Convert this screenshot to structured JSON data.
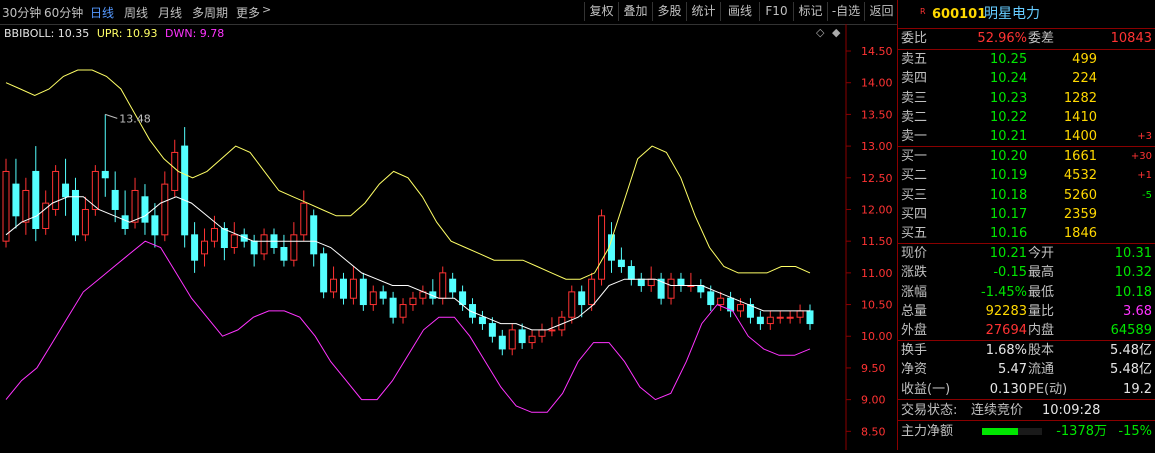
{
  "periods": [
    {
      "label": "30分钟",
      "active": false
    },
    {
      "label": "60分钟",
      "active": false
    },
    {
      "label": "日线",
      "active": true
    },
    {
      "label": "周线",
      "active": false
    },
    {
      "label": "月线",
      "active": false
    },
    {
      "label": "多周期",
      "active": false
    },
    {
      "label": "更多",
      "active": false
    }
  ],
  "tools": [
    "复权",
    "叠加",
    "多股",
    "统计",
    "画线",
    "F10",
    "标记",
    "-自选",
    "返回"
  ],
  "indicator": {
    "name": "BBIBOLL",
    "bbi_text": "BBIBOLL: 10.35",
    "upr_text": "UPR: 10.93",
    "dwn_text": "DWN: 9.78",
    "colors": {
      "bbi": "#ffffff",
      "upr": "#ffff66",
      "dwn": "#ff33ff"
    }
  },
  "chart_data": {
    "type": "candlestick",
    "y_ticks": [
      "14.50",
      "14.00",
      "13.50",
      "13.00",
      "12.50",
      "12.00",
      "11.50",
      "11.00",
      "10.50",
      "10.00",
      "9.50",
      "9.00",
      "8.50"
    ],
    "ylim": [
      8.3,
      14.8
    ],
    "high_annotation": "13.48",
    "candles": [
      [
        11.5,
        12.6,
        11.4,
        12.8
      ],
      [
        12.4,
        11.9,
        11.7,
        12.8
      ],
      [
        11.8,
        12.3,
        11.6,
        12.5
      ],
      [
        12.6,
        11.7,
        11.5,
        13.0
      ],
      [
        11.7,
        12.1,
        11.6,
        12.3
      ],
      [
        12.0,
        12.6,
        11.9,
        12.7
      ],
      [
        12.4,
        12.2,
        11.9,
        12.8
      ],
      [
        12.3,
        11.6,
        11.5,
        12.5
      ],
      [
        11.6,
        12.0,
        11.5,
        12.2
      ],
      [
        12.0,
        12.6,
        11.9,
        12.7
      ],
      [
        12.6,
        12.5,
        12.2,
        13.5
      ],
      [
        12.3,
        12.0,
        11.8,
        12.6
      ],
      [
        11.9,
        11.7,
        11.6,
        12.3
      ],
      [
        11.8,
        12.3,
        11.7,
        12.5
      ],
      [
        12.2,
        11.8,
        11.6,
        12.4
      ],
      [
        11.9,
        11.6,
        11.4,
        12.1
      ],
      [
        11.6,
        12.4,
        11.5,
        12.6
      ],
      [
        12.3,
        12.9,
        12.2,
        13.1
      ],
      [
        13.0,
        11.6,
        11.4,
        13.3
      ],
      [
        11.6,
        11.2,
        11.0,
        11.8
      ],
      [
        11.3,
        11.5,
        11.1,
        11.7
      ],
      [
        11.5,
        11.7,
        11.4,
        11.9
      ],
      [
        11.7,
        11.4,
        11.2,
        11.8
      ],
      [
        11.4,
        11.6,
        11.3,
        11.8
      ],
      [
        11.6,
        11.5,
        11.4,
        11.7
      ],
      [
        11.5,
        11.3,
        11.1,
        11.6
      ],
      [
        11.3,
        11.6,
        11.2,
        11.7
      ],
      [
        11.6,
        11.4,
        11.3,
        11.7
      ],
      [
        11.4,
        11.2,
        11.1,
        11.6
      ],
      [
        11.2,
        11.6,
        11.1,
        11.8
      ],
      [
        11.6,
        12.1,
        11.5,
        12.3
      ],
      [
        11.9,
        11.3,
        11.1,
        12.0
      ],
      [
        11.3,
        10.7,
        10.6,
        11.4
      ],
      [
        10.7,
        10.9,
        10.6,
        11.1
      ],
      [
        10.9,
        10.6,
        10.5,
        11.0
      ],
      [
        10.6,
        10.9,
        10.5,
        11.1
      ],
      [
        10.9,
        10.5,
        10.4,
        11.0
      ],
      [
        10.5,
        10.7,
        10.4,
        10.8
      ],
      [
        10.7,
        10.6,
        10.5,
        10.8
      ],
      [
        10.6,
        10.3,
        10.2,
        10.7
      ],
      [
        10.3,
        10.5,
        10.2,
        10.6
      ],
      [
        10.5,
        10.6,
        10.4,
        10.7
      ],
      [
        10.6,
        10.7,
        10.5,
        10.8
      ],
      [
        10.7,
        10.6,
        10.5,
        10.9
      ],
      [
        10.6,
        11.0,
        10.5,
        11.1
      ],
      [
        10.9,
        10.7,
        10.6,
        11.0
      ],
      [
        10.7,
        10.5,
        10.4,
        10.8
      ],
      [
        10.5,
        10.3,
        10.2,
        10.6
      ],
      [
        10.3,
        10.2,
        10.1,
        10.4
      ],
      [
        10.2,
        10.0,
        9.9,
        10.3
      ],
      [
        10.0,
        9.8,
        9.7,
        10.1
      ],
      [
        9.8,
        10.1,
        9.7,
        10.2
      ],
      [
        10.1,
        9.9,
        9.8,
        10.2
      ],
      [
        9.9,
        10.0,
        9.8,
        10.1
      ],
      [
        10.0,
        10.1,
        9.9,
        10.2
      ],
      [
        10.1,
        10.1,
        10.0,
        10.3
      ],
      [
        10.1,
        10.3,
        10.0,
        10.4
      ],
      [
        10.3,
        10.7,
        10.2,
        10.8
      ],
      [
        10.7,
        10.5,
        10.3,
        10.8
      ],
      [
        10.5,
        10.9,
        10.4,
        11.0
      ],
      [
        10.9,
        11.9,
        10.8,
        12.0
      ],
      [
        11.6,
        11.2,
        11.0,
        11.8
      ],
      [
        11.2,
        11.1,
        11.0,
        11.4
      ],
      [
        11.1,
        10.9,
        10.8,
        11.2
      ],
      [
        10.9,
        10.8,
        10.7,
        11.0
      ],
      [
        10.8,
        10.9,
        10.7,
        11.1
      ],
      [
        10.9,
        10.6,
        10.5,
        11.0
      ],
      [
        10.6,
        10.9,
        10.5,
        11.0
      ],
      [
        10.9,
        10.8,
        10.7,
        11.0
      ],
      [
        10.8,
        10.8,
        10.7,
        11.0
      ],
      [
        10.8,
        10.7,
        10.6,
        10.9
      ],
      [
        10.7,
        10.5,
        10.4,
        10.8
      ],
      [
        10.5,
        10.6,
        10.4,
        10.7
      ],
      [
        10.6,
        10.4,
        10.3,
        10.7
      ],
      [
        10.4,
        10.5,
        10.3,
        10.6
      ],
      [
        10.5,
        10.3,
        10.2,
        10.6
      ],
      [
        10.3,
        10.2,
        10.1,
        10.4
      ],
      [
        10.2,
        10.3,
        10.1,
        10.4
      ],
      [
        10.3,
        10.3,
        10.2,
        10.4
      ],
      [
        10.3,
        10.3,
        10.2,
        10.4
      ],
      [
        10.3,
        10.4,
        10.2,
        10.5
      ],
      [
        10.4,
        10.2,
        10.1,
        10.5
      ]
    ],
    "upr": [
      14.0,
      13.9,
      13.8,
      13.9,
      14.1,
      14.2,
      14.2,
      14.1,
      13.9,
      13.5,
      13.1,
      12.8,
      12.6,
      12.5,
      12.6,
      12.8,
      13.0,
      12.9,
      12.6,
      12.3,
      12.2,
      12.1,
      12.0,
      11.9,
      11.9,
      12.1,
      12.4,
      12.6,
      12.5,
      12.2,
      11.8,
      11.5,
      11.4,
      11.3,
      11.2,
      11.2,
      11.2,
      11.1,
      11.0,
      10.9,
      10.9,
      11.0,
      11.4,
      12.1,
      12.8,
      13.0,
      12.9,
      12.5,
      11.9,
      11.4,
      11.1,
      11.0,
      11.0,
      11.0,
      11.1,
      11.1,
      11.0
    ],
    "upr_x0": 0,
    "bbi": [
      11.6,
      11.8,
      11.9,
      12.1,
      12.2,
      12.2,
      12.0,
      11.9,
      11.8,
      11.9,
      12.1,
      12.2,
      12.1,
      11.9,
      11.7,
      11.6,
      11.5,
      11.5,
      11.5,
      11.5,
      11.5,
      11.4,
      11.2,
      11.0,
      10.9,
      10.8,
      10.8,
      10.7,
      10.6,
      10.6,
      10.4,
      10.3,
      10.2,
      10.2,
      10.1,
      10.1,
      10.2,
      10.3,
      10.5,
      10.8,
      10.9,
      10.9,
      10.9,
      10.8,
      10.8,
      10.8,
      10.7,
      10.6,
      10.5,
      10.4,
      10.4,
      10.4,
      10.4
    ],
    "dwn": [
      9.0,
      9.3,
      9.5,
      9.9,
      10.3,
      10.7,
      10.9,
      11.1,
      11.3,
      11.5,
      11.4,
      11.0,
      10.6,
      10.3,
      10.0,
      10.1,
      10.3,
      10.4,
      10.4,
      10.3,
      10.0,
      9.6,
      9.3,
      9.0,
      9.0,
      9.3,
      9.7,
      10.1,
      10.3,
      10.3,
      10.0,
      9.6,
      9.2,
      8.9,
      8.8,
      8.8,
      9.1,
      9.6,
      9.9,
      9.9,
      9.6,
      9.2,
      9.0,
      9.1,
      9.6,
      10.2,
      10.5,
      10.4,
      10.0,
      9.8,
      9.7,
      9.7,
      9.8
    ]
  },
  "stock": {
    "badge": "R",
    "code": "600101",
    "name": "明星电力"
  },
  "wei": {
    "weibi_label": "委比",
    "weibi_value": "52.96%",
    "weicha_label": "委差",
    "weicha_value": "10843"
  },
  "asks": [
    {
      "label": "卖五",
      "price": "10.25",
      "vol": "499",
      "chg": ""
    },
    {
      "label": "卖四",
      "price": "10.24",
      "vol": "224",
      "chg": ""
    },
    {
      "label": "卖三",
      "price": "10.23",
      "vol": "1282",
      "chg": ""
    },
    {
      "label": "卖二",
      "price": "10.22",
      "vol": "1410",
      "chg": ""
    },
    {
      "label": "卖一",
      "price": "10.21",
      "vol": "1400",
      "chg": "+3"
    }
  ],
  "bids": [
    {
      "label": "买一",
      "price": "10.20",
      "vol": "1661",
      "chg": "+30"
    },
    {
      "label": "买二",
      "price": "10.19",
      "vol": "4532",
      "chg": "+1"
    },
    {
      "label": "买三",
      "price": "10.18",
      "vol": "5260",
      "chg": "-5"
    },
    {
      "label": "买四",
      "price": "10.17",
      "vol": "2359",
      "chg": ""
    },
    {
      "label": "买五",
      "price": "10.16",
      "vol": "1846",
      "chg": ""
    }
  ],
  "quote": [
    {
      "l1": "现价",
      "v1": "10.21",
      "c1": "green",
      "l2": "今开",
      "v2": "10.31",
      "c2": "green"
    },
    {
      "l1": "涨跌",
      "v1": "-0.15",
      "c1": "green",
      "l2": "最高",
      "v2": "10.32",
      "c2": "green"
    },
    {
      "l1": "涨幅",
      "v1": "-1.45%",
      "c1": "green",
      "l2": "最低",
      "v2": "10.18",
      "c2": "green"
    },
    {
      "l1": "总量",
      "v1": "92283",
      "c1": "yellow",
      "l2": "量比",
      "v2": "3.68",
      "c2": "mag"
    },
    {
      "l1": "外盘",
      "v1": "27694",
      "c1": "red",
      "l2": "内盘",
      "v2": "64589",
      "c2": "green"
    }
  ],
  "fund": [
    {
      "l1": "换手",
      "v1": "1.68%",
      "l2": "股本",
      "v2": "5.48亿"
    },
    {
      "l1": "净资",
      "v1": "5.47",
      "l2": "流通",
      "v2": "5.48亿"
    },
    {
      "l1": "收益(一)",
      "v1": "0.130",
      "l2": "PE(动)",
      "v2": "19.2"
    }
  ],
  "trade_state": {
    "label": "交易状态:",
    "value": "连续竞价",
    "time": "10:09:28"
  },
  "main_flow": {
    "label": "主力净额",
    "value": "-1378万",
    "pct": "-15%",
    "fill_fraction": 0.6
  }
}
